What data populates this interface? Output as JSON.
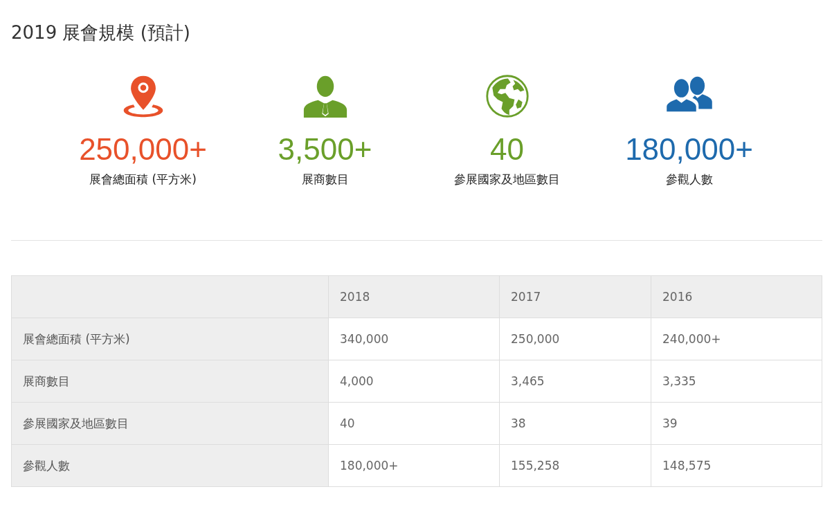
{
  "heading": "2019 展會規模 (預計)",
  "stats": [
    {
      "kind": "pin",
      "color": "#e8512a",
      "value": "250,000+",
      "label": "展會總面積 (平方米)"
    },
    {
      "kind": "person",
      "color": "#6a9f2a",
      "value": "3,500+",
      "label": "展商數目"
    },
    {
      "kind": "globe",
      "color": "#6a9f2a",
      "value": "40",
      "label": "參展國家及地區數目"
    },
    {
      "kind": "people",
      "color": "#1e6aad",
      "value": "180,000+",
      "label": "參觀人數"
    }
  ],
  "table": {
    "columns": [
      "2018",
      "2017",
      "2016"
    ],
    "rows": [
      {
        "label": "展會總面積 (平方米)",
        "cells": [
          "340,000",
          "250,000",
          "240,000+"
        ]
      },
      {
        "label": "展商數目",
        "cells": [
          "4,000",
          "3,465",
          "3,335"
        ]
      },
      {
        "label": "參展國家及地區數目",
        "cells": [
          "40",
          "38",
          "39"
        ]
      },
      {
        "label": "參觀人數",
        "cells": [
          "180,000+",
          "155,258",
          "148,575"
        ]
      }
    ]
  }
}
